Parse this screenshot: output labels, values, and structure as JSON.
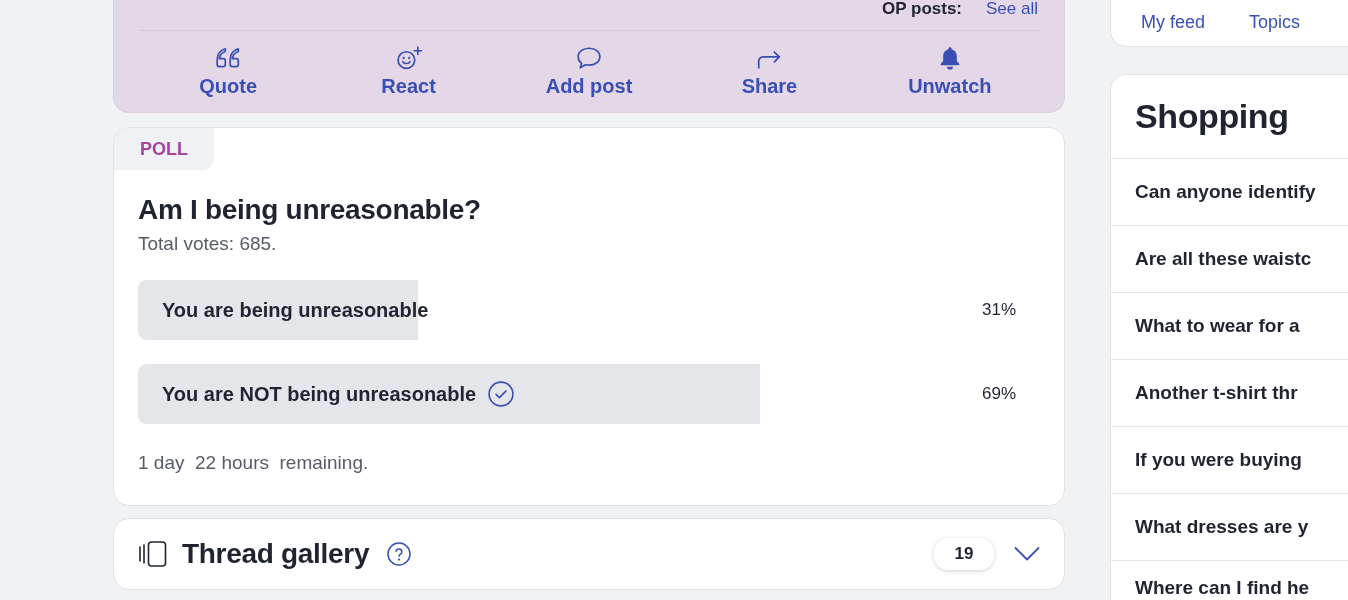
{
  "top_card": {
    "op_posts_label": "OP posts:",
    "see_all_link": "See all",
    "actions": [
      {
        "kind": "quote",
        "label": "Quote"
      },
      {
        "kind": "react",
        "label": "React"
      },
      {
        "kind": "add_post",
        "label": "Add post"
      },
      {
        "kind": "share",
        "label": "Share"
      },
      {
        "kind": "unwatch",
        "label": "Unwatch"
      }
    ]
  },
  "poll": {
    "tag": "POLL",
    "question": "Am I being unreasonable?",
    "total_votes": "Total votes: 685.",
    "options": [
      {
        "label": "You are being unreasonable",
        "percent": "31%",
        "level": 0.31,
        "selected": false
      },
      {
        "label": "You are NOT being unreasonable",
        "percent": "69%",
        "level": 0.69,
        "selected": true
      }
    ],
    "remaining": "1 day  22 hours  remaining."
  },
  "thread_gallery": {
    "title": "Thread gallery",
    "count": "19",
    "expanded": false
  },
  "sidebar": {
    "nav_links": [
      {
        "label": "My feed"
      },
      {
        "label": "Topics"
      }
    ],
    "section": {
      "title": "Shopping",
      "threads": [
        {
          "title": "Can anyone identify"
        },
        {
          "title": "Are all these waistc"
        },
        {
          "title": "What to wear for a"
        },
        {
          "title": "Another t-shirt thr"
        },
        {
          "title": "If you were buying"
        },
        {
          "title": "What dresses are y"
        },
        {
          "title": "Where can I find he"
        }
      ]
    }
  }
}
